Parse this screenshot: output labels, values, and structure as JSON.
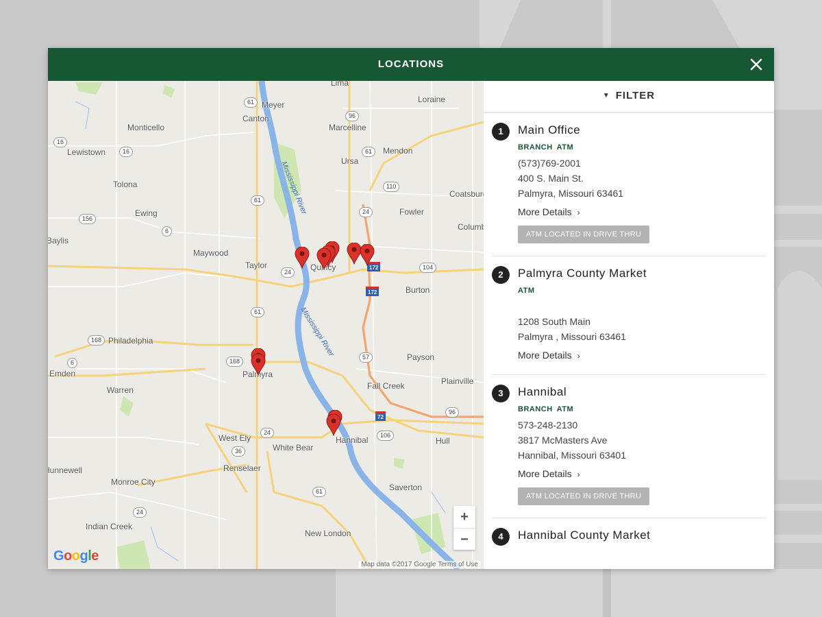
{
  "modal": {
    "title": "LOCATIONS",
    "close_label": "close"
  },
  "filter": {
    "label": "FILTER"
  },
  "map": {
    "city_labels": [
      "Lima",
      "Meyer",
      "Loraine",
      "Canton",
      "Marcelline",
      "Monticello",
      "Mendon",
      "Lewistown",
      "Ursa",
      "Tolona",
      "Coatsburg",
      "Ewing",
      "Fowler",
      "Columbus",
      "Baylis",
      "Maywood",
      "Taylor",
      "Quincy",
      "Burton",
      "Philadelphia",
      "Payson",
      "Emden",
      "Palmyra",
      "Fall Creek",
      "Plainville",
      "Warren",
      "West Ely",
      "Hannibal",
      "Hull",
      "White Bear",
      "Renselaer",
      "Monroe City",
      "Saverton",
      "Indian Creek",
      "New London",
      "Hunnewell"
    ],
    "river_labels": [
      "Mississippi River",
      "Mississippi River"
    ],
    "google_logo": "Google",
    "attribution": "Map data ©2017 Google   Terms of Use",
    "zoom_in": "+",
    "zoom_out": "−"
  },
  "locations": [
    {
      "number": "1",
      "name": "Main Office",
      "tags": [
        "BRANCH",
        "ATM"
      ],
      "phone": "(573)769-2001",
      "address1": "400 S. Main St.",
      "address2": "Palmyra, Missouri 63461",
      "more": "More Details",
      "badge": "ATM LOCATED IN DRIVE THRU"
    },
    {
      "number": "2",
      "name": "Palmyra County Market",
      "tags": [
        "ATM"
      ],
      "phone": "",
      "address1": "1208 South Main",
      "address2": "Palmyra , Missouri 63461",
      "more": "More Details",
      "badge": ""
    },
    {
      "number": "3",
      "name": "Hannibal",
      "tags": [
        "BRANCH",
        "ATM"
      ],
      "phone": "573-248-2130",
      "address1": "3817 McMasters Ave",
      "address2": "Hannibal, Missouri 63401",
      "more": "More Details",
      "badge": "ATM LOCATED IN DRIVE THRU"
    },
    {
      "number": "4",
      "name": "Hannibal County Market",
      "tags": [],
      "phone": "",
      "address1": "",
      "address2": "",
      "more": "",
      "badge": ""
    }
  ],
  "colors": {
    "header": "#175733",
    "accent_tag": "#175733",
    "pin": "#d8322b",
    "map_bg": "#ecebe6",
    "river": "#8ab4e8",
    "road": "#f6d27a",
    "backdrop": "#c9c9c9"
  },
  "icons": {
    "close": "close-icon",
    "filter": "chevron-down-icon",
    "pin": "map-pin-icon",
    "more": "chevron-right-icon"
  }
}
